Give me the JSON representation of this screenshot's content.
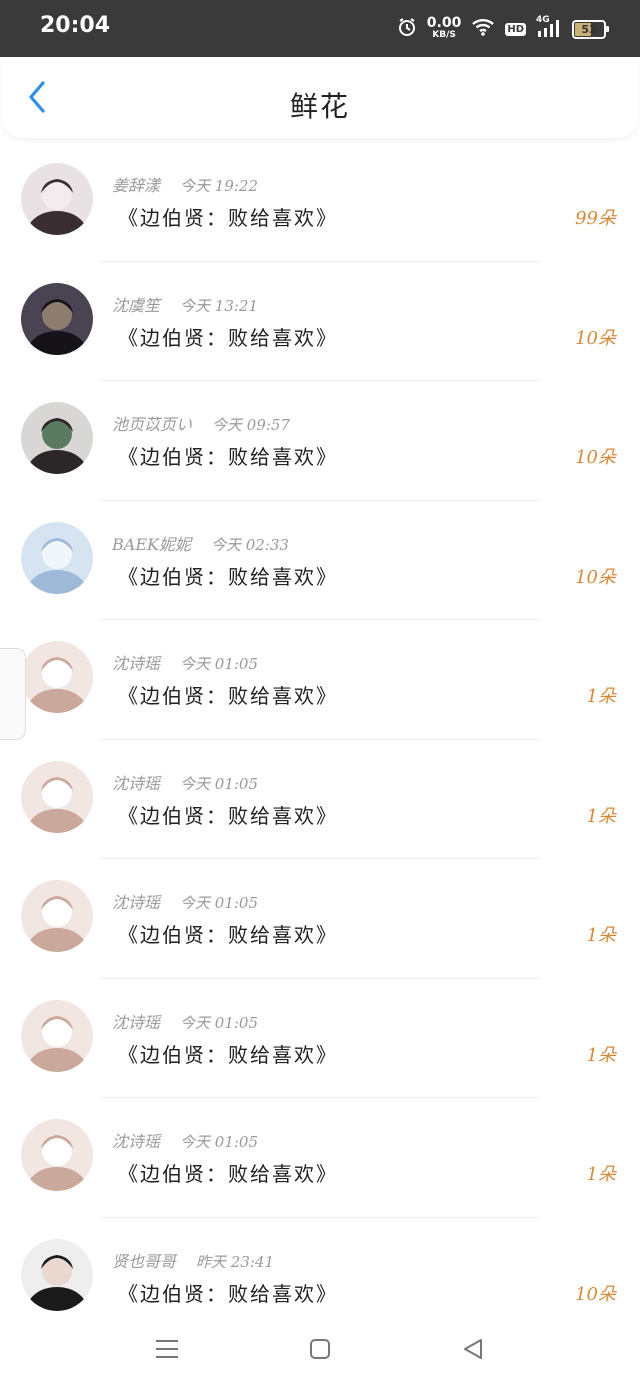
{
  "status_bar": {
    "time": "20:04",
    "net_speed_value": "0.00",
    "net_speed_unit": "KB/S",
    "hd": "HD",
    "network": "4G",
    "battery": "53",
    "battery_level": 0.53,
    "icons": [
      "alarm-icon",
      "wifi-icon",
      "signal-icon",
      "battery-icon"
    ]
  },
  "header": {
    "title": "鲜花",
    "back_icon": "chevron-left-icon"
  },
  "colors": {
    "accent_blue": "#2f8fe8",
    "count_orange": "#d88a3a",
    "meta_gray": "#9a9a9a"
  },
  "rows": [
    {
      "name": "姜辞漾",
      "time": "今天 19:22",
      "message": "《边伯贤：败给喜欢》",
      "count": "99朵"
    },
    {
      "name": "沈虞笙",
      "time": "今天 13:21",
      "message": "《边伯贤：败给喜欢》",
      "count": "10朵"
    },
    {
      "name": "池页苡页い",
      "time": "今天 09:57",
      "message": "《边伯贤：败给喜欢》",
      "count": "10朵"
    },
    {
      "name": "BAEK妮妮",
      "time": "今天 02:33",
      "message": "《边伯贤：败给喜欢》",
      "count": "10朵"
    },
    {
      "name": "沈诗瑶",
      "time": "今天 01:05",
      "message": "《边伯贤：败给喜欢》",
      "count": "1朵"
    },
    {
      "name": "沈诗瑶",
      "time": "今天 01:05",
      "message": "《边伯贤：败给喜欢》",
      "count": "1朵"
    },
    {
      "name": "沈诗瑶",
      "time": "今天 01:05",
      "message": "《边伯贤：败给喜欢》",
      "count": "1朵"
    },
    {
      "name": "沈诗瑶",
      "time": "今天 01:05",
      "message": "《边伯贤：败给喜欢》",
      "count": "1朵"
    },
    {
      "name": "沈诗瑶",
      "time": "今天 01:05",
      "message": "《边伯贤：败给喜欢》",
      "count": "1朵"
    },
    {
      "name": "贤也哥哥",
      "time": "昨天 23:41",
      "message": "《边伯贤：败给喜欢》",
      "count": "10朵"
    }
  ],
  "nav_bar": {
    "buttons": [
      "menu-icon",
      "home-square-icon",
      "back-triangle-icon"
    ]
  }
}
